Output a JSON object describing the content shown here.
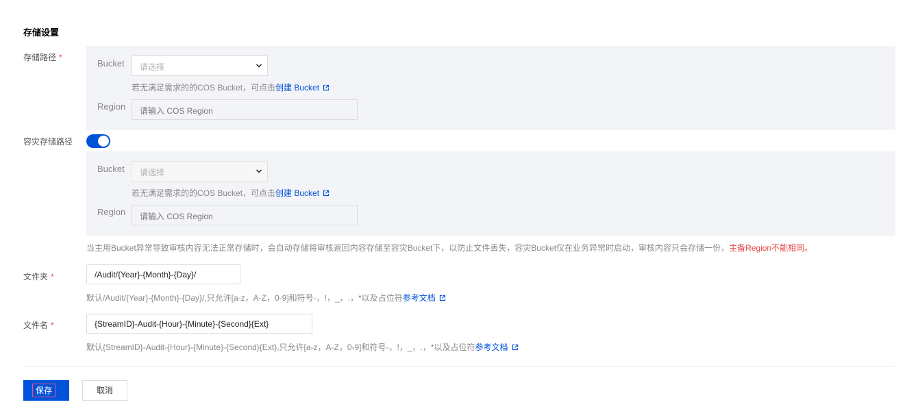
{
  "section_title": "存储设置",
  "required_mark": "*",
  "storage_path": {
    "label": "存储路径",
    "bucket_label": "Bucket",
    "bucket_placeholder": "请选择",
    "hint_prefix": "若无满足需求的的COS Bucket，可点击",
    "create_link": "创建 Bucket",
    "region_label": "Region",
    "region_placeholder": "请输入 COS Region"
  },
  "dr_path": {
    "label": "容灾存储路径",
    "toggle_on": true,
    "bucket_label": "Bucket",
    "bucket_placeholder": "请选择",
    "hint_prefix": "若无满足需求的的COS Bucket，可点击",
    "create_link": "创建 Bucket",
    "region_label": "Region",
    "region_placeholder": "请输入 COS Region"
  },
  "dr_note": {
    "text": "当主用Bucket异常导致审核内容无法正常存储时，会自动存储将审核返回内容存储至容灾Bucket下，以防止文件丢失，容灾Bucket仅在业务异常时启动，审核内容只会存储一份，",
    "warning": "主备Region不能相同。"
  },
  "folder": {
    "label": "文件夹",
    "value": "/Audit/{Year}-{Month}-{Day}/",
    "hint": "默认/Audit/{Year}-{Month}-{Day}/,只允许[a-z，A-Z，0-9]和符号-，!，_，.，*以及占位符",
    "doc_link": "参考文档"
  },
  "filename": {
    "label": "文件名",
    "value": "{StreamID}-Audit-{Hour}-{Minute}-{Second}{Ext}",
    "hint": "默认{StreamID}-Audit-{Hour}-{Minute}-{Second}{Ext},只允许[a-z，A-Z，0-9]和符号-，!，_，.，*以及占位符",
    "doc_link": "参考文档"
  },
  "actions": {
    "save": "保存",
    "cancel": "取消"
  },
  "colors": {
    "primary": "#0052d9",
    "danger": "#e54545"
  }
}
